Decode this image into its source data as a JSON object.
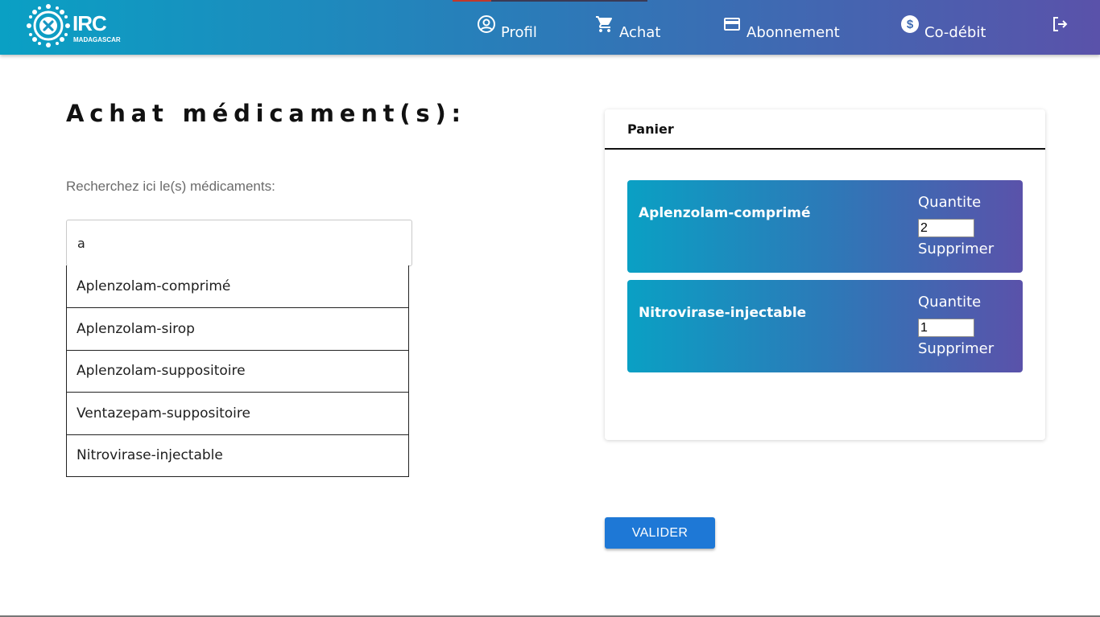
{
  "header": {
    "logo_text": "IRC",
    "logo_subtext": "MADAGASCAR",
    "nav": [
      {
        "label": "Profil",
        "icon": "account-circle-icon"
      },
      {
        "label": "Achat",
        "icon": "shopping-cart-icon"
      },
      {
        "label": "Abonnement",
        "icon": "credit-card-icon"
      },
      {
        "label": "Co-débit",
        "icon": "dollar-circle-icon"
      }
    ],
    "logout_icon": "logout-icon"
  },
  "main": {
    "title": "Achat médicament(s):",
    "search": {
      "label": "Recherchez ici le(s) médicaments:",
      "value": "a",
      "suggestions": [
        "Aplenzolam-comprimé",
        "Aplenzolam-sirop",
        "Aplenzolam-suppositoire",
        "Ventazepam-suppositoire",
        "Nitrovirase-injectable"
      ]
    },
    "cart": {
      "title": "Panier",
      "items": [
        {
          "name": "Aplenzolam-comprimé",
          "quantity_label": "Quantite",
          "quantity": "2",
          "remove_label": "Supprimer"
        },
        {
          "name": "Nitrovirase-injectable",
          "quantity_label": "Quantite",
          "quantity": "1",
          "remove_label": "Supprimer"
        }
      ]
    },
    "validate_label": "VALIDER"
  },
  "colors": {
    "gradient_start": "#0aa0c4",
    "gradient_mid": "#2c7ab8",
    "gradient_end": "#5a52aa",
    "button_blue": "#1e78d6"
  }
}
